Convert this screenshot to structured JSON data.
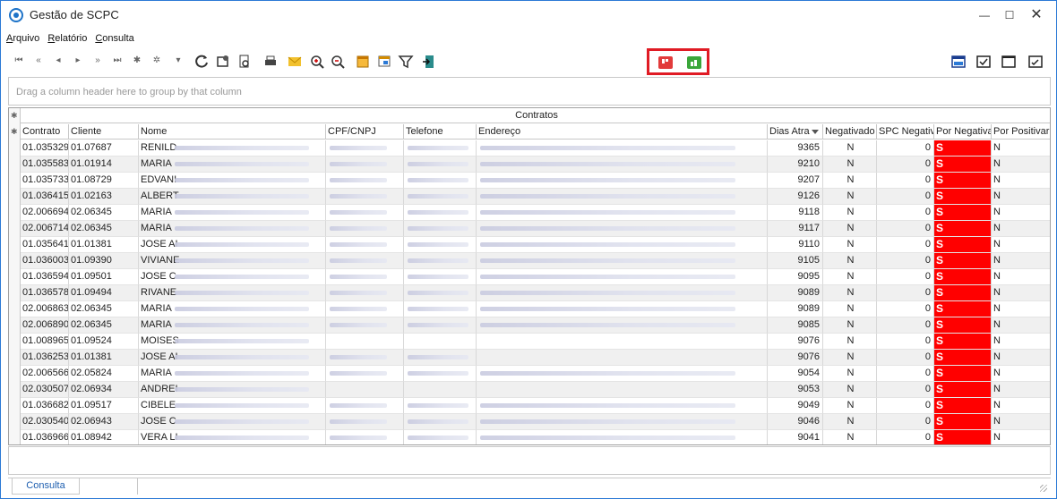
{
  "window": {
    "title": "Gestão de SCPC",
    "controls": {
      "minimize": "—",
      "maximize": "☐",
      "close": "✕"
    }
  },
  "menu": [
    {
      "label": "Arquivo",
      "underline": "A",
      "rest": "rquivo"
    },
    {
      "label": "Relatório",
      "underline": "R",
      "rest": "elatório"
    },
    {
      "label": "Consulta",
      "underline": "C",
      "rest": "onsulta"
    }
  ],
  "toolbar": {
    "nav_icons": [
      "first-record-icon",
      "prev-page-icon",
      "prev-record-icon",
      "next-record-icon",
      "next-page-icon",
      "last-record-icon",
      "insert-record-icon",
      "delete-record-icon",
      "filter-record-icon"
    ],
    "nav_glyphs": [
      "⏮",
      "«",
      "◂",
      "▸",
      "»",
      "⏭",
      "✱",
      "✲",
      "▾"
    ],
    "action_icons": [
      "refresh-icon",
      "settings-icon",
      "print-preview-icon",
      "print-icon",
      "email-icon",
      "zoom-in-icon",
      "zoom-out-icon",
      "export-icon",
      "window-icon",
      "filter-icon",
      "exit-icon"
    ],
    "right_icons": [
      "layout-icon-1",
      "checklist-icon",
      "window-blank-icon",
      "checklist-icon-2"
    ]
  },
  "highlight_buttons": {
    "negativar": "negativar-icon",
    "positivar": "positivar-icon",
    "negativar_color": "#e23b3b",
    "positivar_color": "#3aa63a"
  },
  "group_panel": {
    "placeholder": "Drag a column header here to group by that column"
  },
  "grid": {
    "band_title": "Contratos",
    "columns": [
      "Contrato",
      "Cliente",
      "Nome",
      "CPF/CNPJ",
      "Telefone",
      "Endereço",
      "Dias Atra",
      "Negativado",
      "SPC Negativ",
      "Por Negativa",
      "Por Positivar"
    ],
    "rows": [
      {
        "contrato": "01.035329",
        "cliente": "01.07687",
        "nome": "RENILD",
        "dias": "9365",
        "negativado": "N",
        "spc": "0",
        "por_neg": "S",
        "por_pos": "N"
      },
      {
        "contrato": "01.035583",
        "cliente": "01.01914",
        "nome": "MARIA",
        "dias": "9210",
        "negativado": "N",
        "spc": "0",
        "por_neg": "S",
        "por_pos": "N"
      },
      {
        "contrato": "01.035733",
        "cliente": "01.08729",
        "nome": "EDVANI",
        "dias": "9207",
        "negativado": "N",
        "spc": "0",
        "por_neg": "S",
        "por_pos": "N"
      },
      {
        "contrato": "01.036415",
        "cliente": "01.02163",
        "nome": "ALBERT",
        "dias": "9126",
        "negativado": "N",
        "spc": "0",
        "por_neg": "S",
        "por_pos": "N"
      },
      {
        "contrato": "02.006694",
        "cliente": "02.06345",
        "nome": "MARIA",
        "dias": "9118",
        "negativado": "N",
        "spc": "0",
        "por_neg": "S",
        "por_pos": "N"
      },
      {
        "contrato": "02.006714",
        "cliente": "02.06345",
        "nome": "MARIA",
        "dias": "9117",
        "negativado": "N",
        "spc": "0",
        "por_neg": "S",
        "por_pos": "N"
      },
      {
        "contrato": "01.035641",
        "cliente": "01.01381",
        "nome": "JOSE AI",
        "dias": "9110",
        "negativado": "N",
        "spc": "0",
        "por_neg": "S",
        "por_pos": "N"
      },
      {
        "contrato": "01.036003",
        "cliente": "01.09390",
        "nome": "VIVIANE",
        "dias": "9105",
        "negativado": "N",
        "spc": "0",
        "por_neg": "S",
        "por_pos": "N"
      },
      {
        "contrato": "01.036594",
        "cliente": "01.09501",
        "nome": "JOSE C",
        "dias": "9095",
        "negativado": "N",
        "spc": "0",
        "por_neg": "S",
        "por_pos": "N"
      },
      {
        "contrato": "01.036578",
        "cliente": "01.09494",
        "nome": "RIVANE",
        "dias": "9089",
        "negativado": "N",
        "spc": "0",
        "por_neg": "S",
        "por_pos": "N"
      },
      {
        "contrato": "02.006863",
        "cliente": "02.06345",
        "nome": "MARIA",
        "dias": "9089",
        "negativado": "N",
        "spc": "0",
        "por_neg": "S",
        "por_pos": "N"
      },
      {
        "contrato": "02.006890",
        "cliente": "02.06345",
        "nome": "MARIA",
        "dias": "9085",
        "negativado": "N",
        "spc": "0",
        "por_neg": "S",
        "por_pos": "N"
      },
      {
        "contrato": "01.008965",
        "cliente": "01.09524",
        "nome": "MOISES",
        "dias": "9076",
        "negativado": "N",
        "spc": "0",
        "por_neg": "S",
        "por_pos": "N"
      },
      {
        "contrato": "01.036253",
        "cliente": "01.01381",
        "nome": "JOSE AI",
        "dias": "9076",
        "negativado": "N",
        "spc": "0",
        "por_neg": "S",
        "por_pos": "N"
      },
      {
        "contrato": "02.006566",
        "cliente": "02.05824",
        "nome": "MARIA",
        "dias": "9054",
        "negativado": "N",
        "spc": "0",
        "por_neg": "S",
        "por_pos": "N"
      },
      {
        "contrato": "02.030507",
        "cliente": "02.06934",
        "nome": "ANDREI",
        "dias": "9053",
        "negativado": "N",
        "spc": "0",
        "por_neg": "S",
        "por_pos": "N"
      },
      {
        "contrato": "01.036682",
        "cliente": "01.09517",
        "nome": "CIBELE",
        "dias": "9049",
        "negativado": "N",
        "spc": "0",
        "por_neg": "S",
        "por_pos": "N"
      },
      {
        "contrato": "02.030540",
        "cliente": "02.06943",
        "nome": "JOSE C",
        "dias": "9046",
        "negativado": "N",
        "spc": "0",
        "por_neg": "S",
        "por_pos": "N"
      },
      {
        "contrato": "01.036966",
        "cliente": "01.08942",
        "nome": "VERA LI",
        "dias": "9041",
        "negativado": "N",
        "spc": "0",
        "por_neg": "S",
        "por_pos": "N"
      }
    ]
  },
  "tabs": [
    {
      "label": "Consulta"
    }
  ],
  "colors": {
    "accent": "#2b79d6",
    "negativa_cell": "#ff0000",
    "highlight_box": "#e01b24"
  }
}
